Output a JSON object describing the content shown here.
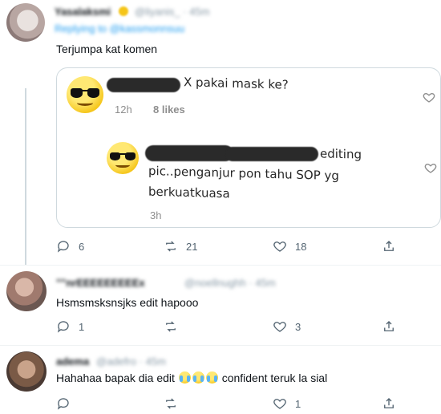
{
  "tweet1": {
    "username": "Yasalaksmi",
    "handle": "@liyanis_ · 45m",
    "replying_to": "Replying to @kassmonnsuu",
    "text": "Terjumpa kat komen",
    "embed": {
      "comment1": {
        "text": "X pakai mask ke?",
        "time": "12h",
        "likes": "8 likes"
      },
      "comment2": {
        "text_line1": "editing",
        "text_line2": "pic..penganjur pon tahu SOP yg",
        "text_line3": "berkuatkuasa",
        "time": "3h"
      }
    },
    "actions": {
      "replies": "6",
      "retweets": "21",
      "likes": "18"
    }
  },
  "tweet2": {
    "username": "\"\"nrEEEEEEEEEx",
    "handle": "@noellnughh · 45m",
    "text": "Hsmsmsksnsjks edit hapooo",
    "actions": {
      "replies": "1",
      "retweets": "",
      "likes": "3"
    }
  },
  "tweet3": {
    "username": "adema",
    "handle": "@adefro · 45m",
    "text_before": "Hahahaa bapak dia edit",
    "emojis": [
      "loudly-crying-face",
      "loudly-crying-face",
      "loudly-crying-face"
    ],
    "text_after": "confident teruk la sial",
    "actions": {
      "replies": "",
      "retweets": "",
      "likes": "1"
    }
  },
  "colors": {
    "text": "#0f1419",
    "muted": "#536471",
    "border": "#cfd9de",
    "link": "#1d9bf0"
  }
}
